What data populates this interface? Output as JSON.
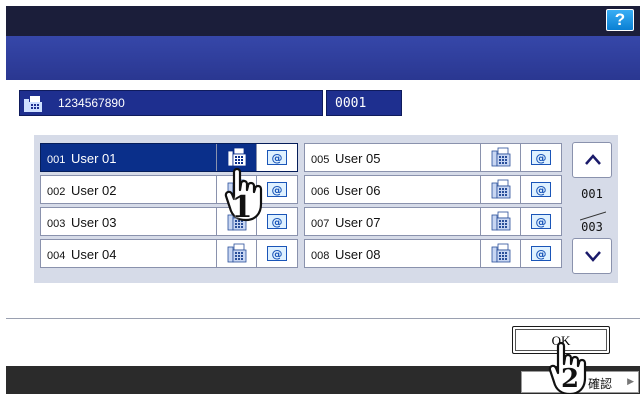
{
  "header": {
    "help_label": "?"
  },
  "destination": {
    "fax_number": "1234567890",
    "count": "0001"
  },
  "address_book": {
    "rows": [
      {
        "no": "001",
        "name": "User 01",
        "selected": true,
        "fax_active": true
      },
      {
        "no": "002",
        "name": "User 02",
        "selected": false,
        "fax_active": false
      },
      {
        "no": "003",
        "name": "User 03",
        "selected": false,
        "fax_active": false
      },
      {
        "no": "004",
        "name": "User 04",
        "selected": false,
        "fax_active": false
      },
      {
        "no": "005",
        "name": "User 05",
        "selected": false,
        "fax_active": false
      },
      {
        "no": "006",
        "name": "User 06",
        "selected": false,
        "fax_active": false
      },
      {
        "no": "007",
        "name": "User 07",
        "selected": false,
        "fax_active": false
      },
      {
        "no": "008",
        "name": "User 08",
        "selected": false,
        "fax_active": false
      }
    ]
  },
  "pager": {
    "current": "001",
    "total": "003"
  },
  "footer": {
    "ok_label": "OK",
    "confirm_label": "確認"
  },
  "callouts": {
    "step1": "1",
    "step2": "2"
  },
  "colors": {
    "selected_row": "#0a2f8a",
    "title_bar": "#2a3791",
    "help_button": "#0a7fd3"
  }
}
